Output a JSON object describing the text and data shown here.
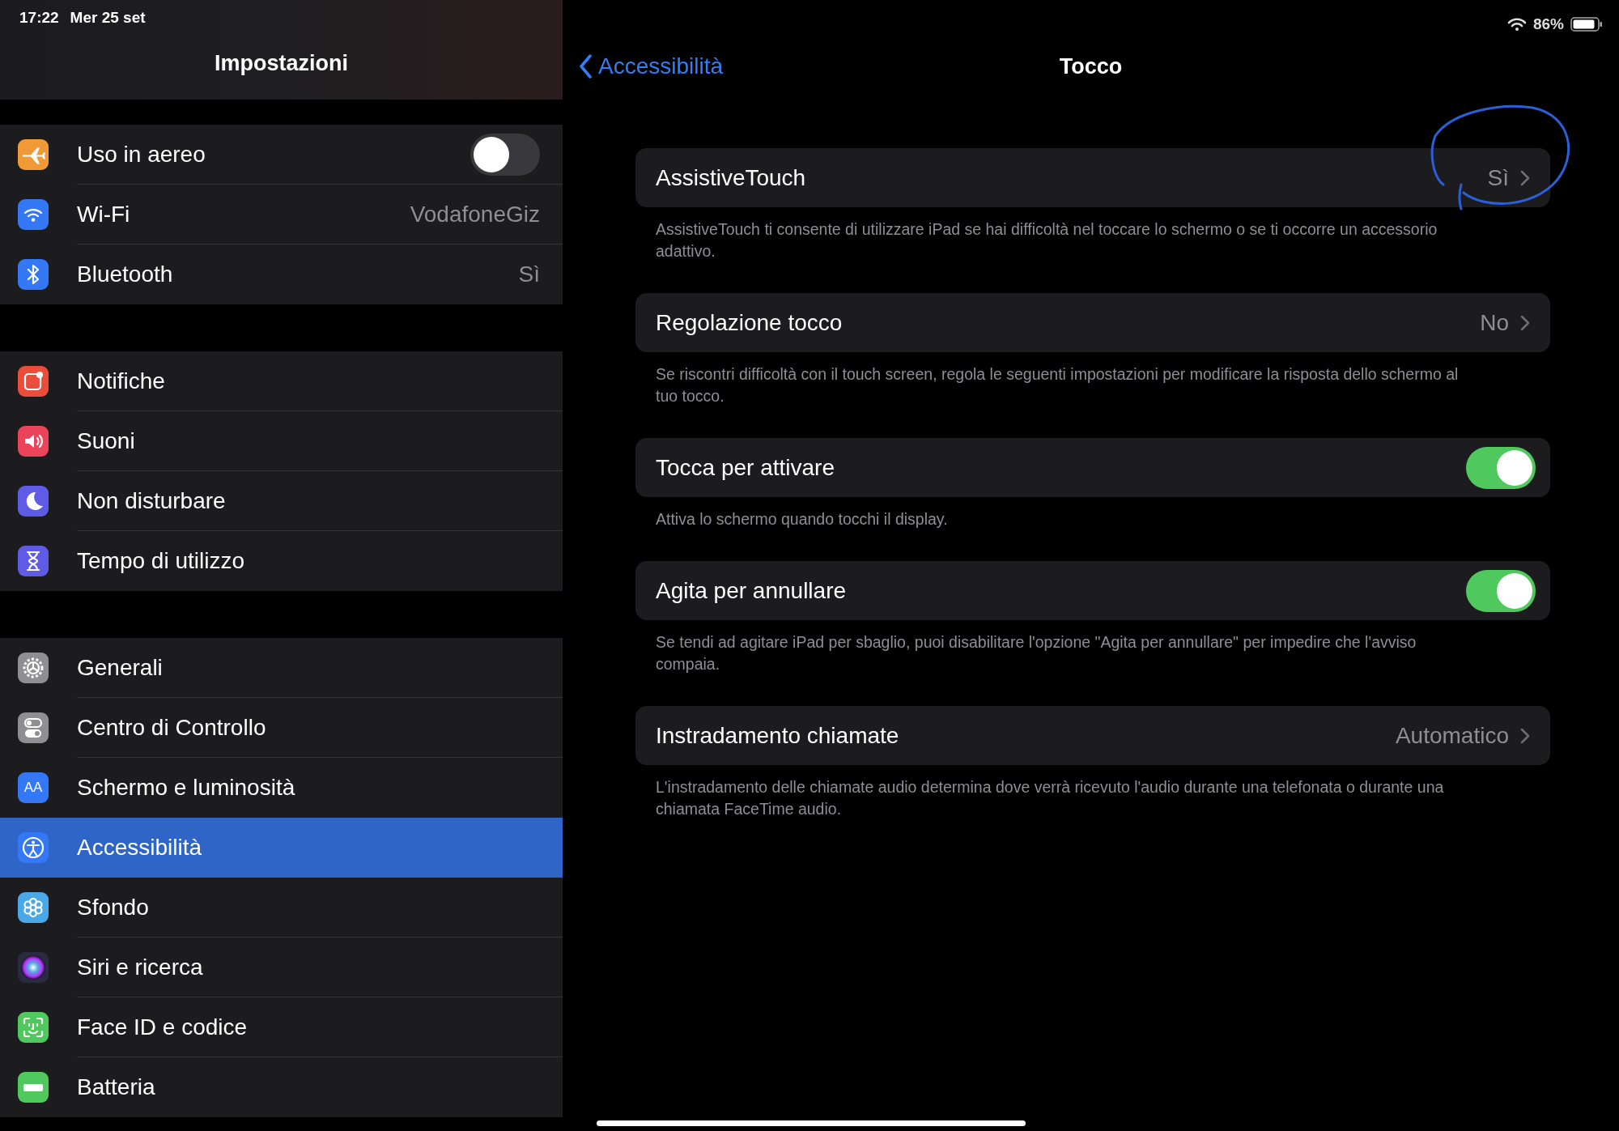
{
  "status_bar": {
    "time": "17:22",
    "date": "Mer 25 set",
    "battery_percent": "86%"
  },
  "sidebar": {
    "title": "Impostazioni",
    "groups": [
      {
        "items": [
          {
            "label": "Uso in aereo",
            "kind": "airplane",
            "color": "#f09a37",
            "on": false,
            "selected": false
          },
          {
            "label": "Wi-Fi",
            "kind": "wifi",
            "color": "#3478f6",
            "value": "VodafoneGiz",
            "selected": false
          },
          {
            "label": "Bluetooth",
            "kind": "bluetooth",
            "color": "#3478f6",
            "value": "Sì",
            "selected": false
          }
        ]
      },
      {
        "items": [
          {
            "label": "Notifiche",
            "kind": "notifications",
            "color": "#eb4d3d",
            "selected": false
          },
          {
            "label": "Suoni",
            "kind": "speaker",
            "color": "#eb445a",
            "selected": false
          },
          {
            "label": "Non disturbare",
            "kind": "moon",
            "color": "#5e5ce6",
            "selected": false
          },
          {
            "label": "Tempo di utilizzo",
            "kind": "hourglass",
            "color": "#5e5ce6",
            "selected": false
          }
        ]
      },
      {
        "items": [
          {
            "label": "Generali",
            "kind": "gear",
            "color": "#8e8e93",
            "selected": false
          },
          {
            "label": "Centro di Controllo",
            "kind": "switches",
            "color": "#8e8e93",
            "selected": false
          },
          {
            "label": "Schermo e luminosità",
            "kind": "display",
            "icon_text": "AA",
            "color": "#3478f6",
            "selected": false
          },
          {
            "label": "Accessibilità",
            "kind": "accessibility",
            "color": "#3478f6",
            "selected": true
          },
          {
            "label": "Sfondo",
            "kind": "flower",
            "color": "#4aa7e8",
            "selected": false
          },
          {
            "label": "Siri e ricerca",
            "kind": "siri",
            "color": "#2a2a40",
            "selected": false
          },
          {
            "label": "Face ID e codice",
            "kind": "faceid",
            "color": "#4fc95e",
            "selected": false
          },
          {
            "label": "Batteria",
            "kind": "battery",
            "color": "#4fc95e",
            "selected": false
          }
        ]
      }
    ]
  },
  "detail": {
    "back": "Accessibilità",
    "title": "Tocco",
    "sections": [
      {
        "label": "AssistiveTouch",
        "kind": "link",
        "value": "Sì",
        "footer": "AssistiveTouch ti consente di utilizzare iPad se hai difficoltà nel toccare lo schermo o se ti occorre un accessorio adattivo."
      },
      {
        "label": "Regolazione tocco",
        "kind": "link",
        "value": "No",
        "footer": "Se riscontri difficoltà con il touch screen, regola le seguenti impostazioni per modificare la risposta dello schermo al tuo tocco."
      },
      {
        "label": "Tocca per attivare",
        "kind": "toggle",
        "on": true,
        "footer": "Attiva lo schermo quando tocchi il display."
      },
      {
        "label": "Agita per annullare",
        "kind": "toggle",
        "on": true,
        "footer": "Se tendi ad agitare iPad per sbaglio, puoi disabilitare l'opzione \"Agita per annullare\" per impedire che l'avviso compaia."
      },
      {
        "label": "Instradamento chiamate",
        "kind": "link",
        "value": "Automatico",
        "footer": "L'instradamento delle chiamate audio determina dove verrà ricevuto l'audio durante una telefonata o durante una chiamata FaceTime audio."
      }
    ]
  }
}
